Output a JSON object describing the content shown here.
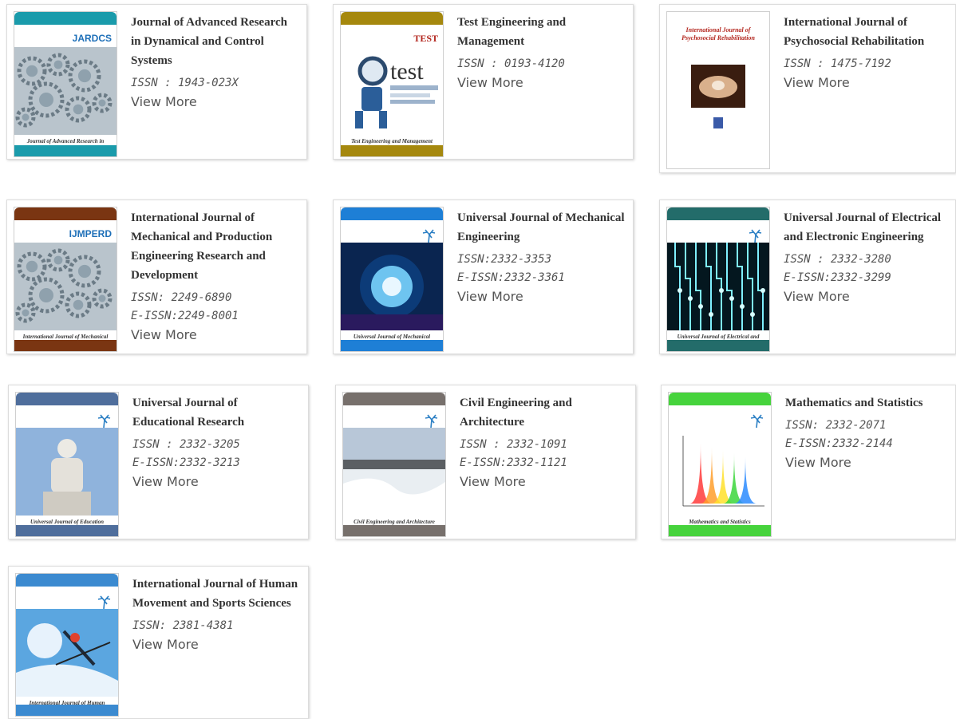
{
  "view_more_label": "View More",
  "journals": [
    {
      "title": "Journal of Advanced Research in Dynamical and Control Systems",
      "issn_lines": [
        "ISSN : 1943-023X"
      ],
      "cover": {
        "accent": "#1a9bab",
        "cover_title": "Journal of Advanced Research in Dynamical and Control Systems",
        "brand": "JARDCS",
        "art": "gears"
      }
    },
    {
      "title": "Test Engineering and Management",
      "issn_lines": [
        "ISSN : 0193-4120"
      ],
      "cover": {
        "accent": "#a5880e",
        "cover_title": "Test Engineering and Management",
        "brand": "TEST",
        "art": "robot"
      }
    },
    {
      "title": "International Journal of Psychosocial Rehabilitation",
      "issn_lines": [
        "ISSN : 1475-7192"
      ],
      "cover": {
        "accent": "#ffffff",
        "cover_title": "International Journal of Psychosocial Rehabilitation",
        "brand": "",
        "art": "hands"
      }
    },
    {
      "title": "International Journal of Mechanical and Production Engineering Research and Development",
      "issn_lines": [
        "ISSN: 2249-6890",
        "E-ISSN:2249-8001"
      ],
      "cover": {
        "accent": "#7a3512",
        "cover_title": "International Journal of Mechanical and Production Engineering Research and Development",
        "brand": "IJMPERD",
        "art": "gears"
      }
    },
    {
      "title": "Universal Journal of Mechanical Engineering",
      "issn_lines": [
        "ISSN:2332-3353",
        "E-ISSN:2332-3361"
      ],
      "cover": {
        "accent": "#1e7fd6",
        "cover_title": "Universal Journal of Mechanical Engineering",
        "brand": "",
        "art": "machine"
      }
    },
    {
      "title": "Universal Journal of Electrical and Electronic Engineering",
      "issn_lines": [
        "ISSN : 2332-3280",
        "E-ISSN:2332-3299"
      ],
      "cover": {
        "accent": "#236c6a",
        "cover_title": "Universal Journal of Electrical and Electronic Engineering",
        "brand": "",
        "art": "circuit"
      }
    },
    {
      "title": "Universal Journal of Educational Research",
      "issn_lines": [
        "ISSN : 2332-3205",
        "E-ISSN:2332-3213"
      ],
      "cover": {
        "accent": "#4f6e9c",
        "cover_title": "Universal Journal of Education Research",
        "brand": "",
        "art": "statue"
      }
    },
    {
      "title": "Civil Engineering and Architecture",
      "issn_lines": [
        "ISSN : 2332-1091",
        "E-ISSN:2332-1121"
      ],
      "cover": {
        "accent": "#77706c",
        "cover_title": "Civil Engineering and Architecture",
        "brand": "",
        "art": "dam"
      }
    },
    {
      "title": "Mathematics and Statistics",
      "issn_lines": [
        "ISSN: 2332-2071",
        "E-ISSN:2332-2144"
      ],
      "cover": {
        "accent": "#46d33c",
        "cover_title": "Mathematics and Statistics",
        "brand": "",
        "art": "surface"
      }
    },
    {
      "title": "International Journal of Human Movement and Sports Sciences",
      "issn_lines": [
        "ISSN: 2381-4381"
      ],
      "cover": {
        "accent": "#3b8ad0",
        "cover_title": "International Journal of Human Movement and Sports Sciences",
        "brand": "",
        "art": "ski"
      }
    }
  ]
}
